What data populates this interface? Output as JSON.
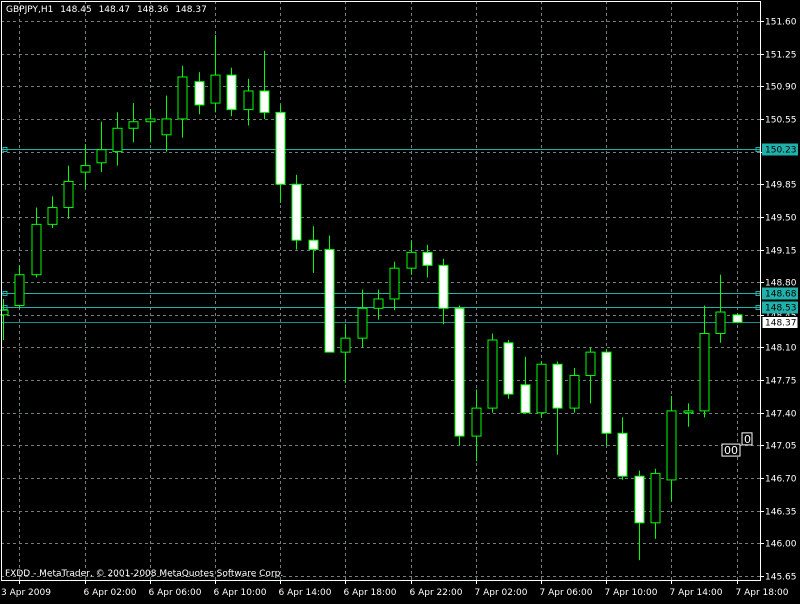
{
  "header": {
    "symbol": "GBPJPY,H1",
    "open": "148.45",
    "high": "148.47",
    "low": "148.36",
    "close": "148.37"
  },
  "copyright": "FXDD - MetaTrader, © 2001-2008 MetaQuotes Software Corp.",
  "colors": {
    "background": "#000000",
    "grid": "#6e7f7f",
    "bull_candle": "#000000",
    "bear_candle": "#ffffff",
    "candle_outline": "#00ff00",
    "level_line": "#20b2aa",
    "price_tag_fill": "#ffffff"
  },
  "level_lines": [
    {
      "label": "150.23",
      "value": 150.23
    },
    {
      "label": "148.68",
      "value": 148.68
    },
    {
      "label": "148.53",
      "value": 148.53
    }
  ],
  "current_price": {
    "label": "148.37",
    "value": 148.37
  },
  "pattern_labels": [
    {
      "text": "00",
      "index": 45,
      "price": 147.0
    },
    {
      "text": "0",
      "index": 46,
      "price": 147.12
    }
  ],
  "chart_data": {
    "type": "candlestick",
    "ylim": [
      145.58,
      151.75
    ],
    "y_ticks": [
      "151.60",
      "151.25",
      "150.90",
      "150.55",
      "150.20",
      "149.85",
      "149.50",
      "149.15",
      "148.80",
      "148.45",
      "148.10",
      "147.75",
      "147.40",
      "147.05",
      "146.70",
      "146.35",
      "146.00",
      "145.65"
    ],
    "x_ticks": [
      {
        "label": "3 Apr 2009",
        "index": 1
      },
      {
        "label": "6 Apr 02:00",
        "index": 5
      },
      {
        "label": "6 Apr 06:00",
        "index": 9
      },
      {
        "label": "6 Apr 10:00",
        "index": 13
      },
      {
        "label": "6 Apr 14:00",
        "index": 17
      },
      {
        "label": "6 Apr 18:00",
        "index": 21
      },
      {
        "label": "6 Apr 22:00",
        "index": 25
      },
      {
        "label": "7 Apr 02:00",
        "index": 29
      },
      {
        "label": "7 Apr 06:00",
        "index": 33
      },
      {
        "label": "7 Apr 10:00",
        "index": 37
      },
      {
        "label": "7 Apr 14:00",
        "index": 41
      },
      {
        "label": "7 Apr 18:00",
        "index": 45
      }
    ],
    "candles": [
      {
        "open": 148.45,
        "high": 148.62,
        "low": 148.18,
        "close": 148.5
      },
      {
        "open": 148.55,
        "high": 148.98,
        "low": 148.52,
        "close": 148.88
      },
      {
        "open": 148.88,
        "high": 149.6,
        "low": 148.85,
        "close": 149.42
      },
      {
        "open": 149.42,
        "high": 149.72,
        "low": 149.38,
        "close": 149.6
      },
      {
        "open": 149.6,
        "high": 150.05,
        "low": 149.48,
        "close": 149.88
      },
      {
        "open": 149.98,
        "high": 150.28,
        "low": 149.8,
        "close": 150.05
      },
      {
        "open": 150.08,
        "high": 150.52,
        "low": 149.98,
        "close": 150.22
      },
      {
        "open": 150.2,
        "high": 150.62,
        "low": 150.05,
        "close": 150.45
      },
      {
        "open": 150.45,
        "high": 150.72,
        "low": 150.3,
        "close": 150.52
      },
      {
        "open": 150.52,
        "high": 150.65,
        "low": 150.3,
        "close": 150.55
      },
      {
        "open": 150.38,
        "high": 150.8,
        "low": 150.2,
        "close": 150.55
      },
      {
        "open": 150.55,
        "high": 151.12,
        "low": 150.35,
        "close": 151.0
      },
      {
        "open": 150.95,
        "high": 151.05,
        "low": 150.6,
        "close": 150.7
      },
      {
        "open": 150.72,
        "high": 151.45,
        "low": 150.62,
        "close": 151.02
      },
      {
        "open": 151.02,
        "high": 151.1,
        "low": 150.58,
        "close": 150.65
      },
      {
        "open": 150.65,
        "high": 150.98,
        "low": 150.48,
        "close": 150.85
      },
      {
        "open": 150.85,
        "high": 151.28,
        "low": 150.55,
        "close": 150.62
      },
      {
        "open": 150.62,
        "high": 150.7,
        "low": 149.65,
        "close": 149.85
      },
      {
        "open": 149.85,
        "high": 149.95,
        "low": 149.15,
        "close": 149.25
      },
      {
        "open": 149.25,
        "high": 149.4,
        "low": 148.9,
        "close": 149.15
      },
      {
        "open": 149.15,
        "high": 149.3,
        "low": 148.1,
        "close": 148.05
      },
      {
        "open": 148.05,
        "high": 148.35,
        "low": 147.72,
        "close": 148.2
      },
      {
        "open": 148.2,
        "high": 148.72,
        "low": 148.1,
        "close": 148.52
      },
      {
        "open": 148.52,
        "high": 148.72,
        "low": 148.4,
        "close": 148.62
      },
      {
        "open": 148.62,
        "high": 149.02,
        "low": 148.5,
        "close": 148.95
      },
      {
        "open": 148.95,
        "high": 149.25,
        "low": 148.88,
        "close": 149.12
      },
      {
        "open": 149.12,
        "high": 149.2,
        "low": 148.85,
        "close": 148.98
      },
      {
        "open": 148.98,
        "high": 149.05,
        "low": 148.35,
        "close": 148.52
      },
      {
        "open": 148.52,
        "high": 148.55,
        "low": 147.05,
        "close": 147.15
      },
      {
        "open": 147.15,
        "high": 147.65,
        "low": 146.88,
        "close": 147.45
      },
      {
        "open": 147.45,
        "high": 148.25,
        "low": 147.4,
        "close": 148.18
      },
      {
        "open": 148.15,
        "high": 148.18,
        "low": 147.55,
        "close": 147.6
      },
      {
        "open": 147.7,
        "high": 148.0,
        "low": 147.4,
        "close": 147.4
      },
      {
        "open": 147.4,
        "high": 147.95,
        "low": 147.35,
        "close": 147.92
      },
      {
        "open": 147.92,
        "high": 147.95,
        "low": 146.95,
        "close": 147.45
      },
      {
        "open": 147.45,
        "high": 147.88,
        "low": 147.4,
        "close": 147.8
      },
      {
        "open": 147.8,
        "high": 148.1,
        "low": 147.5,
        "close": 148.05
      },
      {
        "open": 148.05,
        "high": 148.08,
        "low": 147.05,
        "close": 147.18
      },
      {
        "open": 147.18,
        "high": 147.35,
        "low": 146.68,
        "close": 146.72
      },
      {
        "open": 146.72,
        "high": 146.78,
        "low": 145.82,
        "close": 146.22
      },
      {
        "open": 146.22,
        "high": 146.8,
        "low": 146.05,
        "close": 146.75
      },
      {
        "open": 146.68,
        "high": 147.58,
        "low": 146.45,
        "close": 147.42
      },
      {
        "open": 147.4,
        "high": 147.5,
        "low": 147.25,
        "close": 147.42
      },
      {
        "open": 147.42,
        "high": 148.55,
        "low": 147.35,
        "close": 148.25
      },
      {
        "open": 148.25,
        "high": 148.88,
        "low": 148.15,
        "close": 148.48
      },
      {
        "open": 148.45,
        "high": 148.47,
        "low": 148.36,
        "close": 148.37
      }
    ]
  }
}
